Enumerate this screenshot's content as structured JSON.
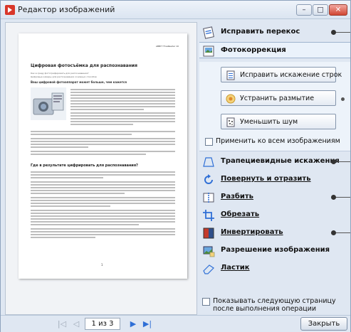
{
  "window": {
    "title": "Редактор изображений"
  },
  "document": {
    "header": "ABBYY FineReader 10",
    "title": "Цифровая фотосъёмка для распознавания",
    "toc": [
      "Как в среду фотографировать для распознавания?",
      "Цифровые камеры для распознавания основных способов"
    ],
    "subtitle": "Ваш цифровой фотоаппарат может больше, чем кажется",
    "section_heading": "Где в результате цифрировать для распознавания?",
    "page_number": "1"
  },
  "tools": {
    "fix_skew": "Исправить перекос",
    "photo_correction": "Фотокоррекция",
    "fix_distortion": "Исправить искажение строк",
    "remove_blur": "Устранить размытие",
    "reduce_noise": "Уменьшить шум",
    "apply_all": "Применить ко всем изображениям",
    "trapezoid": "Трапециевидные искажения",
    "rotate_flip": "Повернуть и отразить",
    "split": "Разбить",
    "crop": "Обрезать",
    "invert": "Инвертировать",
    "resolution": "Разрешение изображения",
    "eraser": "Ластик",
    "show_next_page": "Показывать следующую страницу после выполнения операции"
  },
  "navigation": {
    "page_indicator": "1 из 3",
    "close": "Закрыть"
  },
  "colors": {
    "accent": "#2f6fd6",
    "panel": "#edf3fa",
    "close_button": "#d04632"
  }
}
